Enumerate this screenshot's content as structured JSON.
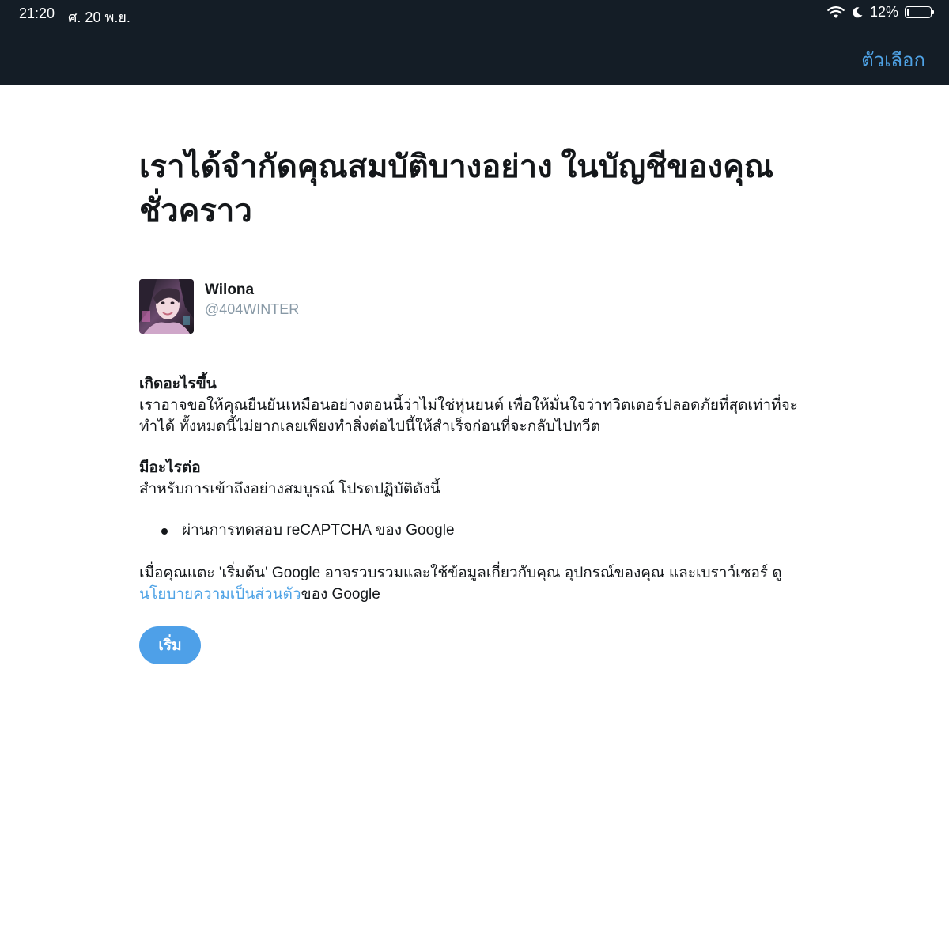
{
  "status_bar": {
    "time": "21:20",
    "date": "ศ. 20 พ.ย.",
    "battery_percent": "12%",
    "battery_level": 0.12,
    "icons": [
      "wifi-icon",
      "moon-icon",
      "battery-icon"
    ]
  },
  "nav": {
    "options_label": "ตัวเลือก"
  },
  "page": {
    "title_line1": "เราได้จำกัดคุณสมบัติบางอย่าง ในบัญชีของคุณ",
    "title_line2": "ชั่วคราว"
  },
  "account": {
    "display_name": "Wilona",
    "handle": "@404WINTER"
  },
  "what_happened": {
    "heading": "เกิดอะไรขึ้น",
    "line1": "เราอาจขอให้คุณยืนยันเหมือนอย่างตอนนี้ว่าไม่ใช่หุ่นยนต์ เพื่อให้มั่นใจว่าทวิตเตอร์ปลอดภัยที่สุดเท่าที่จะ",
    "line2": "ทำได้ ทั้งหมดนี้ไม่ยากเลยเพียงทำสิ่งต่อไปนี้ให้สำเร็จก่อนที่จะกลับไปทวีต"
  },
  "what_next": {
    "heading": "มีอะไรต่อ",
    "text": "สำหรับการเข้าถึงอย่างสมบูรณ์ โปรดปฏิบัติดังนี้",
    "items": [
      "ผ่านการทดสอบ reCAPTCHA ของ Google"
    ]
  },
  "consent": {
    "line1": "เมื่อคุณแตะ 'เริ่มต้น' Google อาจรวบรวมและใช้ข้อมูลเกี่ยวกับคุณ อุปกรณ์ของคุณ และเบราว์เซอร์ ดู",
    "link_text": "นโยบายความเป็นส่วนตัว",
    "after_link": "ของ Google"
  },
  "start_button_label": "เริ่ม",
  "colors": {
    "top_bar": "#141d26",
    "link": "#4fa3e6",
    "button": "#4ea0e8",
    "handle": "#8899a6"
  }
}
